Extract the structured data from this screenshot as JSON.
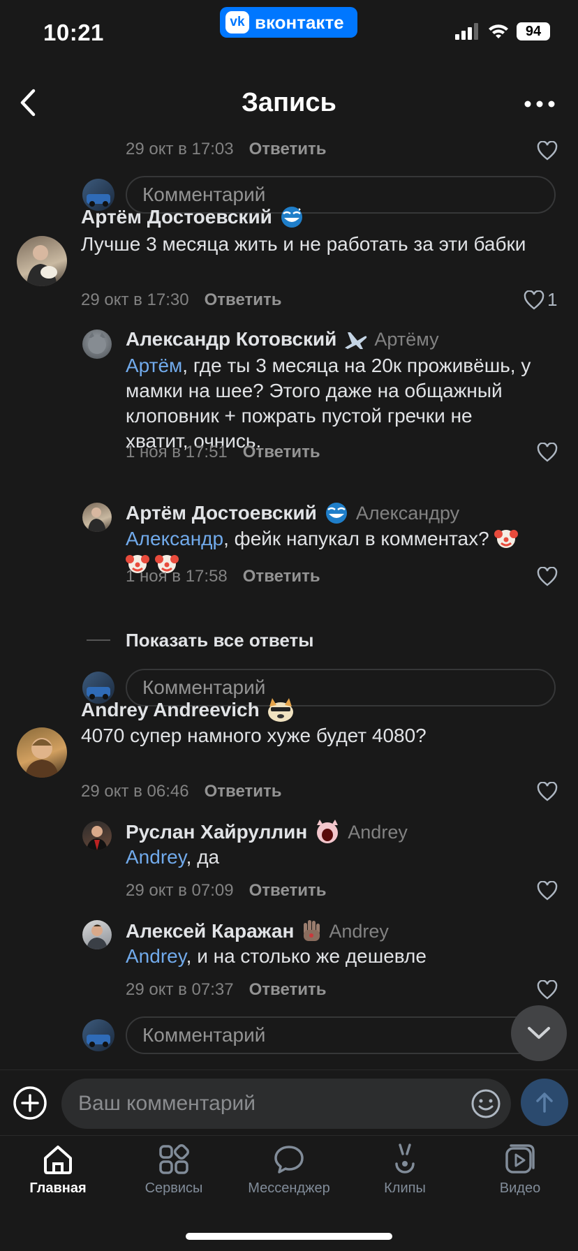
{
  "status_bar": {
    "time": "10:21",
    "app_badge": "вконтакте",
    "battery": "94"
  },
  "header": {
    "title": "Запись"
  },
  "comments": {
    "top_partial": {
      "date": "29 окт в 17:03",
      "reply": "Ответить"
    },
    "comment_placeholder": "Комментарий",
    "c1": {
      "author": "Артём Достоевский",
      "text": "Лучше 3 месяца жить и не работать за эти бабки",
      "date": "29 окт в 17:30",
      "reply": "Ответить",
      "likes": "1",
      "replies": [
        {
          "author": "Александр Котовский",
          "to": "Артёму",
          "mention": "Артём",
          "text_lines": [
            ", где ты 3 месяца на 20к проживёшь, у",
            "мамки на шее? Этого даже на общажный",
            "клоповник + пожрать пустой гречки не",
            "хватит, очнись."
          ],
          "date": "1 ноя в 17:51",
          "reply": "Ответить"
        },
        {
          "author": "Артём Достоевский",
          "to": "Александру",
          "mention": "Александр",
          "text": ", фейк напукал в комментах? ",
          "date": "1 ноя в 17:58",
          "reply": "Ответить"
        }
      ],
      "show_all": "Показать все ответы"
    },
    "c2": {
      "author": "Andrey Andreevich",
      "text": "4070 супер намного хуже будет 4080?",
      "date": "29 окт в 06:46",
      "reply": "Ответить",
      "replies": [
        {
          "author": "Руслан Хайруллин",
          "to": "Andrey",
          "mention": "Andrey",
          "text": ", да",
          "date": "29 окт в 07:09",
          "reply": "Ответить"
        },
        {
          "author": "Алексей Каражан",
          "to": "Andrey",
          "mention": "Andrey",
          "text": ", и на столько же дешевле",
          "date": "29 окт в 07:37",
          "reply": "Ответить"
        }
      ]
    }
  },
  "composer": {
    "placeholder": "Ваш комментарий"
  },
  "tabs": [
    "Главная",
    "Сервисы",
    "Мессенджер",
    "Клипы",
    "Видео"
  ],
  "colors": {
    "background": "#191919",
    "accent": "#71aaeb",
    "brand": "#0077ff"
  }
}
